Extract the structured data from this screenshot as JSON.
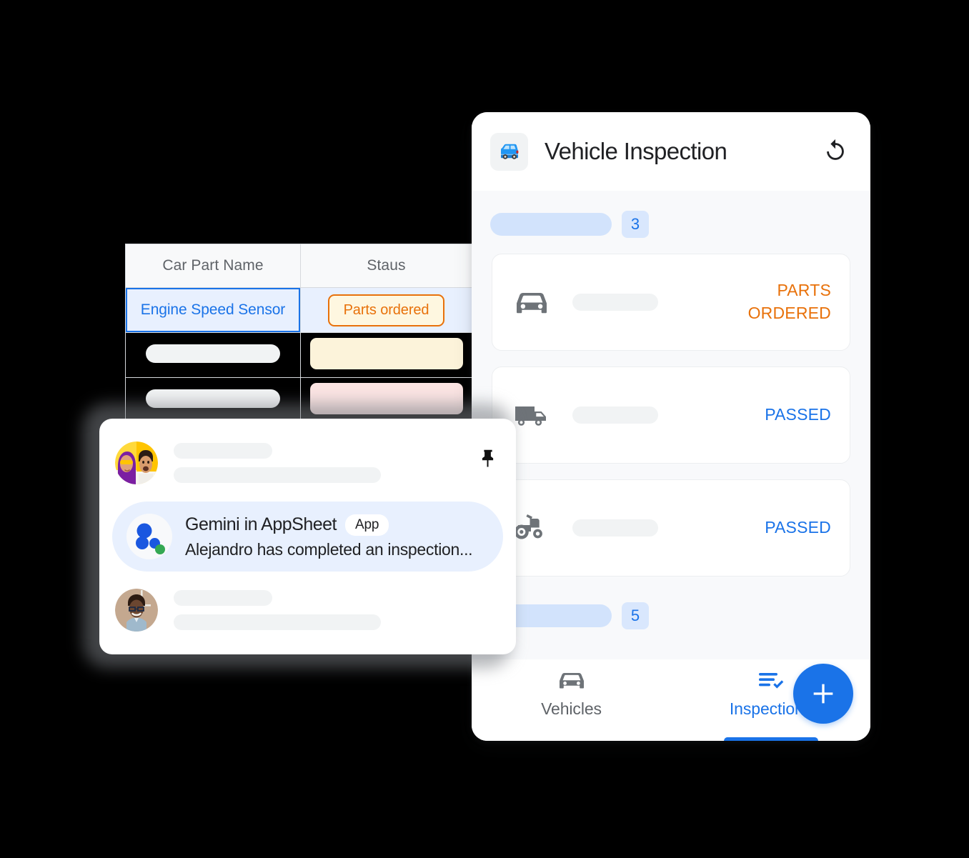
{
  "table": {
    "columns": [
      "Car Part Name",
      "Staus"
    ],
    "rows": [
      {
        "name": "Engine Speed Sensor",
        "status": "Parts ordered",
        "selected": true
      },
      {
        "name": "",
        "status": "",
        "selected": false
      },
      {
        "name": "",
        "status": "",
        "selected": false
      }
    ],
    "colors": {
      "selection": "#1a73e8",
      "selected_cell_bg": "#e8f0fe",
      "chip_border": "#e8710a",
      "chip_bg": "#fef7e0",
      "header_bg": "#f8f9fa",
      "header_text": "#5f6368"
    }
  },
  "phone": {
    "header": {
      "app_icon": "blue-car-icon",
      "title": "Vehicle Inspection",
      "refresh_icon": "refresh-icon"
    },
    "top_filter": {
      "count": "3"
    },
    "bottom_filter": {
      "count": "5"
    },
    "inspections": [
      {
        "icon": "car-icon",
        "status": "PARTS\nORDERED",
        "status_line1": "PARTS",
        "status_line2": "ORDERED",
        "color": "#e8710a"
      },
      {
        "icon": "truck-icon",
        "status": "PASSED",
        "status_line1": "PASSED",
        "status_line2": "",
        "color": "#1a73e8"
      },
      {
        "icon": "tractor-icon",
        "status": "PASSED",
        "status_line1": "PASSED",
        "status_line2": "",
        "color": "#1a73e8"
      }
    ],
    "fab": {
      "icon": "plus-icon",
      "label": "+"
    },
    "nav": [
      {
        "icon": "car-icon",
        "label": "Vehicles",
        "active": false
      },
      {
        "icon": "checklist-icon",
        "label": "Inspections",
        "active": true
      }
    ]
  },
  "chat": {
    "pin_icon": "pushpin-icon",
    "message": {
      "avatar": "gemini-logo-icon",
      "sender": "Gemini in AppSheet",
      "badge": "App",
      "preview": "Alejandro has completed an  inspection..."
    }
  }
}
